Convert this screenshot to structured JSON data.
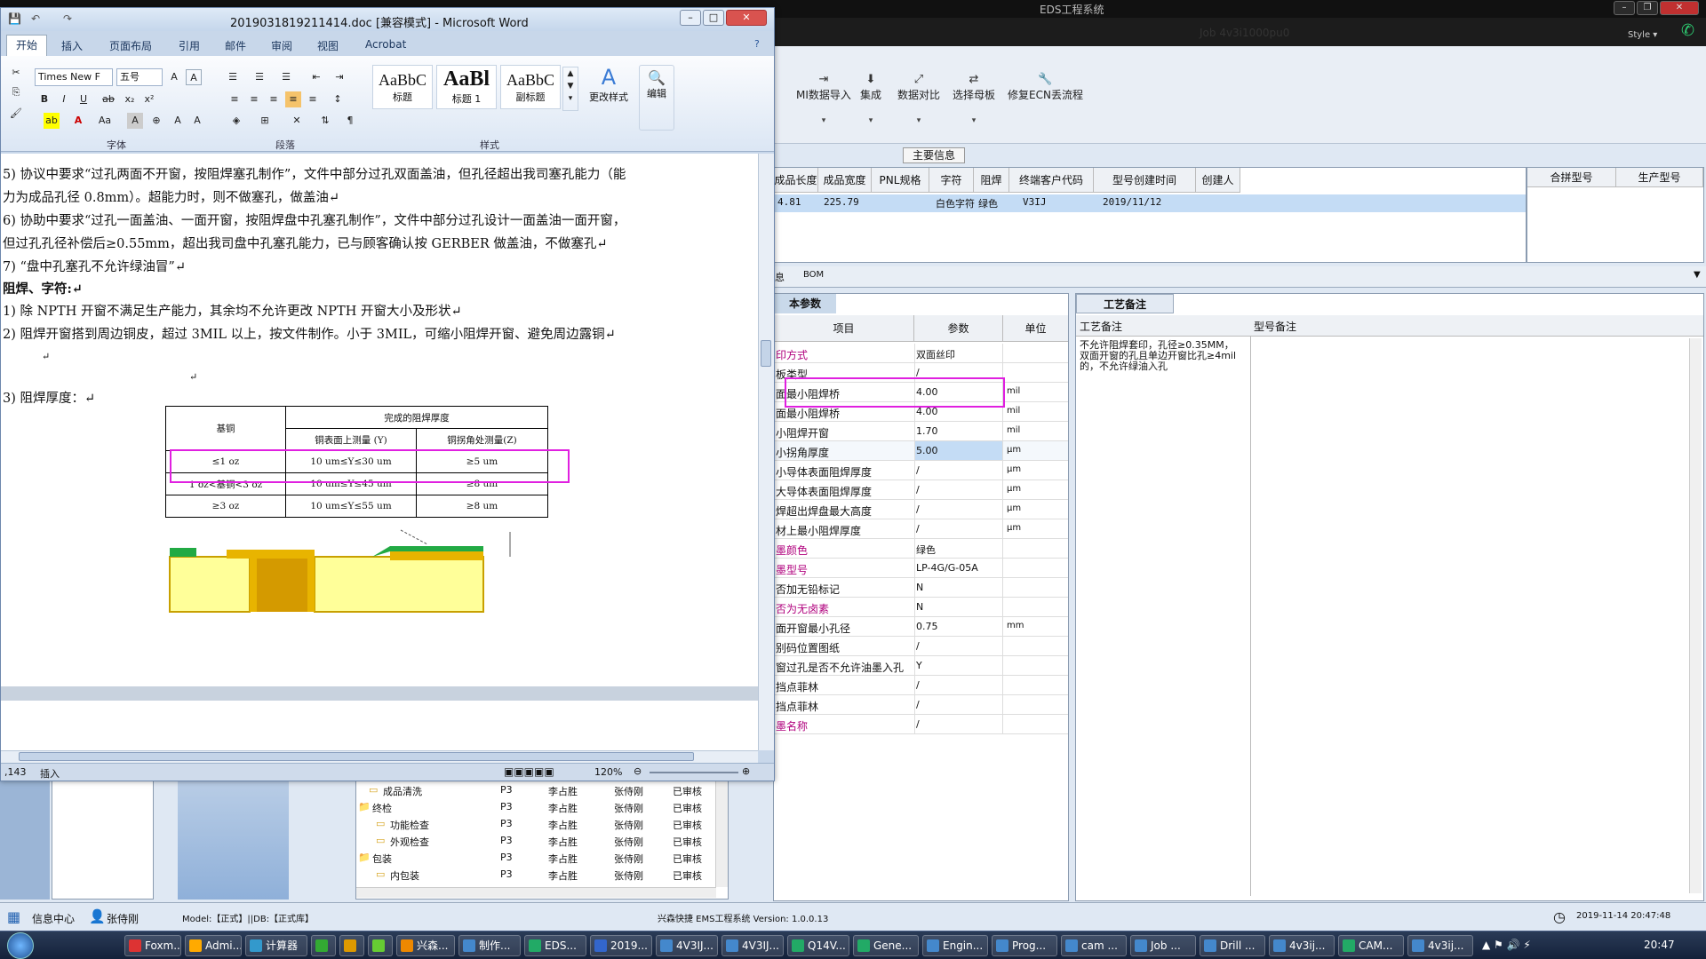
{
  "eds": {
    "title": "EDS工程系统",
    "header_faded": "Job   4v3i1000pu0",
    "style_label": "Style ▾",
    "ribbon": [
      {
        "label": "MI数据导入",
        "icon": "import-icon"
      },
      {
        "label": "集成",
        "icon": "integrate-icon"
      },
      {
        "label": "数据对比",
        "icon": "compare-icon"
      },
      {
        "label": "选择母板",
        "icon": "select-board-icon"
      },
      {
        "label": "修复ECN丢流程",
        "icon": "repair-icon"
      }
    ],
    "main_info_label": "主要信息",
    "main_table": {
      "columns": [
        "成品长度",
        "成品宽度",
        "PNL规格",
        "字符",
        "阻焊",
        "终端客户代码",
        "型号创建时间",
        "创建人"
      ],
      "row": [
        "4.81",
        "225.79",
        "",
        "白色字符",
        "绿色",
        "V3IJ",
        "2019/11/12",
        ""
      ]
    },
    "right_columns": [
      "合拼型号",
      "生产型号"
    ],
    "tabs": [
      "息",
      "BOM"
    ],
    "params": {
      "title": "本参数",
      "columns": [
        "项目",
        "参数",
        "单位"
      ],
      "rows": [
        {
          "name": "印方式",
          "value": "双面丝印",
          "unit": "",
          "mag": true
        },
        {
          "name": "板类型",
          "value": "/",
          "unit": "",
          "mag": false
        },
        {
          "name": "面最小阻焊桥",
          "value": "4.00",
          "unit": "mil",
          "mag": false
        },
        {
          "name": "面最小阻焊桥",
          "value": "4.00",
          "unit": "mil",
          "mag": false
        },
        {
          "name": "小阻焊开窗",
          "value": "1.70",
          "unit": "mil",
          "mag": false
        },
        {
          "name": "小拐角厚度",
          "value": "5.00",
          "unit": "μm",
          "mag": false
        },
        {
          "name": "小导体表面阻焊厚度",
          "value": "/",
          "unit": "μm",
          "mag": false
        },
        {
          "name": "大导体表面阻焊厚度",
          "value": "/",
          "unit": "μm",
          "mag": false
        },
        {
          "name": "焊超出焊盘最大高度",
          "value": "/",
          "unit": "μm",
          "mag": false
        },
        {
          "name": "材上最小阻焊厚度",
          "value": "/",
          "unit": "μm",
          "mag": false
        },
        {
          "name": "墨颜色",
          "value": "绿色",
          "unit": "",
          "mag": true
        },
        {
          "name": "墨型号",
          "value": "LP-4G/G-05A",
          "unit": "",
          "mag": true
        },
        {
          "name": "否加无铅标记",
          "value": "N",
          "unit": "",
          "mag": false
        },
        {
          "name": "否为无卤素",
          "value": "N",
          "unit": "",
          "mag": true
        },
        {
          "name": "面开窗最小孔径",
          "value": "0.75",
          "unit": "mm",
          "mag": false
        },
        {
          "name": "别码位置图纸",
          "value": "/",
          "unit": "",
          "mag": false
        },
        {
          "name": "窗过孔是否不允许油墨入孔",
          "value": "Y",
          "unit": "",
          "mag": false
        },
        {
          "name": "挡点菲林",
          "value": "/",
          "unit": "",
          "mag": false
        },
        {
          "name": "挡点菲林",
          "value": "/",
          "unit": "",
          "mag": false
        },
        {
          "name": "墨名称",
          "value": "/",
          "unit": "",
          "mag": true
        }
      ]
    },
    "process": {
      "tab": "工艺备注",
      "columns": [
        "工艺备注",
        "型号备注"
      ],
      "note": "不允许阻焊套印，孔径≥0.35MM，双面开窗的孔且单边开窗比孔≥4mil的，不允许绿油入孔"
    },
    "tree": [
      {
        "name": "成品清洗",
        "c1": "P3",
        "c2": "李占胜",
        "c3": "张侍刚",
        "c4": "已审核"
      },
      {
        "name": "终检",
        "c1": "P3",
        "c2": "李占胜",
        "c3": "张侍刚",
        "c4": "已审核"
      },
      {
        "name": "功能检查",
        "c1": "P3",
        "c2": "李占胜",
        "c3": "张侍刚",
        "c4": "已审核"
      },
      {
        "name": "外观检查",
        "c1": "P3",
        "c2": "李占胜",
        "c3": "张侍刚",
        "c4": "已审核"
      },
      {
        "name": "包装",
        "c1": "P3",
        "c2": "李占胜",
        "c3": "张侍刚",
        "c4": "已审核"
      },
      {
        "name": "内包装",
        "c1": "P3",
        "c2": "李占胜",
        "c3": "张侍刚",
        "c4": "已审核"
      }
    ],
    "status": {
      "info_center": "信息中心",
      "user": "张侍刚",
      "model": "Model:【正式】||DB:【正式库】",
      "app": "兴森快捷 EMS工程系统  Version: 1.0.0.13",
      "datetime": "2019-11-14 20:47:48"
    }
  },
  "word": {
    "title": "2019031819211414.doc [兼容模式] - Microsoft Word",
    "tabs": [
      "开始",
      "插入",
      "页面布局",
      "引用",
      "邮件",
      "审阅",
      "视图",
      "Acrobat"
    ],
    "font_name": "Times New F",
    "font_size": "五号",
    "styles": [
      {
        "sample": "AaBbC",
        "label": "标题"
      },
      {
        "sample": "AaBl",
        "label": "标题 1"
      },
      {
        "sample": "AaBbC",
        "label": "副标题"
      }
    ],
    "change_styles": "更改样式",
    "edit": "编辑",
    "group_labels": [
      "字体",
      "段落",
      "样式"
    ],
    "lines": [
      "5)  协议中要求“过孔两面不开窗，按阻焊塞孔制作”，文件中部分过孔双面盖油，但孔径超出我司塞孔能力（能",
      "     力为成品孔径 0.8mm）。超能力时，则不做塞孔，做盖油↵",
      "6)  协助中要求“过孔一面盖油、一面开窗，按阻焊盘中孔塞孔制作”，文件中部分过孔设计一面盖油一面开窗，",
      "     但过孔孔径补偿后≥0.55mm，超出我司盘中孔塞孔能力，已与顾客确认按 GERBER 做盖油，不做塞孔↵",
      "7)    “盘中孔塞孔不允许绿油冒”↵",
      "   阻焊、字符:↵",
      "1)  除 NPTH 开窗不满足生产能力，其余均不允许更改 NPTH 开窗大小及形状↵",
      "2)  阻焊开窗搭到周边铜皮，超过 3MIL 以上，按文件制作。小于 3MIL，可缩小阻焊开窗、避免周边露铜↵",
      "3)     阻焊厚度：↵"
    ],
    "table": {
      "base": "基铜",
      "finished": "完成的阻焊厚度",
      "col_y": "铜表面上测量 (Y)",
      "col_z": "铜拐角处测量(Z)",
      "rows": [
        [
          "≤1 oz",
          "10 um≤Y≤30 um",
          "≥5 um"
        ],
        [
          "1 oz<基铜<3 oz",
          "10 um≤Y≤45 um",
          "≥8 um"
        ],
        [
          "≥3 oz",
          "10 um≤Y≤55 um",
          "≥8 um"
        ]
      ]
    },
    "status_page": ",143",
    "status_mode": "插入",
    "zoom": "120%"
  },
  "taskbar": {
    "items": [
      "Foxm...",
      "Admi...",
      "计算器",
      "",
      "",
      "",
      "兴森...",
      "制作...",
      "EDS...",
      "2019...",
      "4V3IJ...",
      "4V3IJ...",
      "Q14V...",
      "Gene...",
      "Engin...",
      "Prog...",
      "cam ...",
      "Job ...",
      "Drill ...",
      "4v3ij...",
      "CAM...",
      "4v3ij..."
    ],
    "clock": "20:47"
  }
}
